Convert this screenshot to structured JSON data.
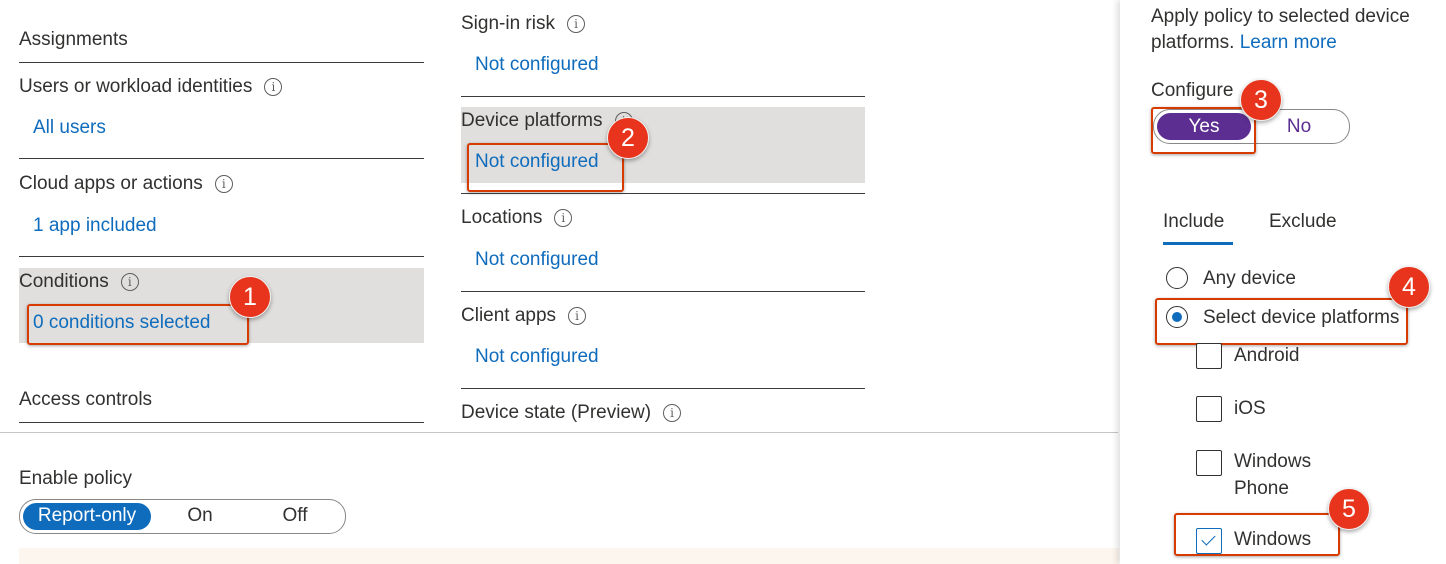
{
  "info_glyph": "i",
  "left": {
    "assignments_title": "Assignments",
    "users_label": "Users or workload identities",
    "users_value": "All users",
    "cloud_label": "Cloud apps or actions",
    "cloud_value": "1 app included",
    "conditions_label": "Conditions",
    "conditions_value": "0 conditions selected",
    "access_controls_title": "Access controls",
    "enable_policy_label": "Enable policy",
    "enable_policy_options": [
      "Report-only",
      "On",
      "Off"
    ],
    "enable_policy_selected": "Report-only"
  },
  "middle": {
    "sign_in_risk_label": "Sign-in risk",
    "sign_in_risk_value": "Not configured",
    "device_platforms_label": "Device platforms",
    "device_platforms_value": "Not configured",
    "locations_label": "Locations",
    "locations_value": "Not configured",
    "client_apps_label": "Client apps",
    "client_apps_value": "Not configured",
    "device_state_label": "Device state (Preview)"
  },
  "panel": {
    "description_line1": "Apply policy to selected device",
    "description_line2": "platforms.",
    "learn_more": "Learn more",
    "configure_label": "Configure",
    "configure_yes": "Yes",
    "configure_no": "No",
    "configure_selected": "Yes",
    "tab_include": "Include",
    "tab_exclude": "Exclude",
    "active_tab": "Include",
    "radio_any": "Any device",
    "radio_select": "Select device platforms",
    "selected_radio": "Select device platforms",
    "platforms": [
      {
        "label_line1": "Android",
        "label_line2": "",
        "checked": false
      },
      {
        "label_line1": "iOS",
        "label_line2": "",
        "checked": false
      },
      {
        "label_line1": "Windows",
        "label_line2": "Phone",
        "checked": false
      },
      {
        "label_line1": "Windows",
        "label_line2": "",
        "checked": true
      }
    ]
  },
  "callouts": [
    "1",
    "2",
    "3",
    "4",
    "5"
  ],
  "colors": {
    "link": "#0f6cbd",
    "callout_border": "#d83b01",
    "badge": "#e8341c",
    "toggle_yes": "#5c2e91",
    "selected_pill": "#0f6cbd",
    "highlight_row": "#e1dfdd"
  }
}
